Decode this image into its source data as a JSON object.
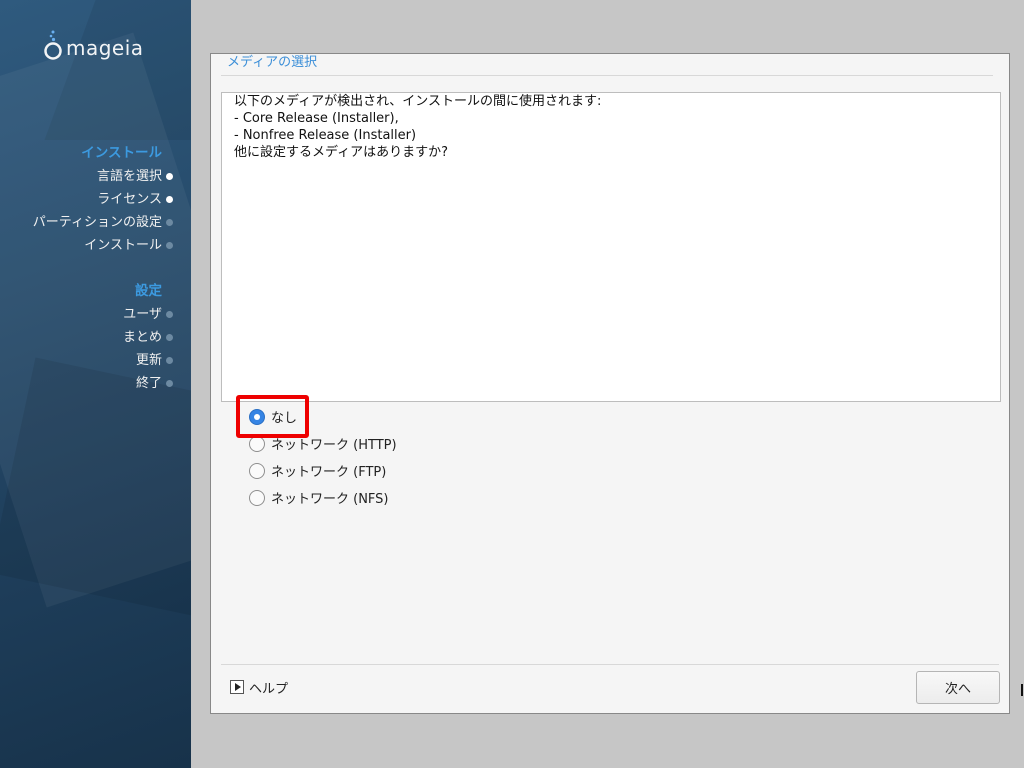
{
  "sidebar": {
    "logo_text": "mageia",
    "groups": [
      {
        "heading": "インストール",
        "items": [
          {
            "label": "言語を選択",
            "done": true
          },
          {
            "label": "ライセンス",
            "done": true
          },
          {
            "label": "パーティションの設定",
            "done": false
          },
          {
            "label": "インストール",
            "done": false
          }
        ]
      },
      {
        "heading": "設定",
        "items": [
          {
            "label": "ユーザ",
            "done": false
          },
          {
            "label": "まとめ",
            "done": false
          },
          {
            "label": "更新",
            "done": false
          },
          {
            "label": "終了",
            "done": false
          }
        ]
      }
    ]
  },
  "window": {
    "title": "メディアの選択",
    "message": {
      "line1": "以下のメディアが検出され、インストールの間に使用されます:",
      "line2": "",
      "line3": "- Core Release (Installer),",
      "line4": "- Nonfree Release (Installer)",
      "line5": "",
      "line6": "他に設定するメディアはありますか?"
    },
    "options": [
      {
        "label": "なし",
        "selected": true
      },
      {
        "label": "ネットワーク (HTTP)",
        "selected": false
      },
      {
        "label": "ネットワーク (FTP)",
        "selected": false
      },
      {
        "label": "ネットワーク (NFS)",
        "selected": false
      }
    ],
    "help_label": "ヘルプ",
    "next_label": "次へ"
  },
  "colors": {
    "accent": "#3c8fd8",
    "sidebar_heading": "#3c9ae0",
    "highlight": "#ee0000",
    "radio_selected": "#3584e4"
  }
}
